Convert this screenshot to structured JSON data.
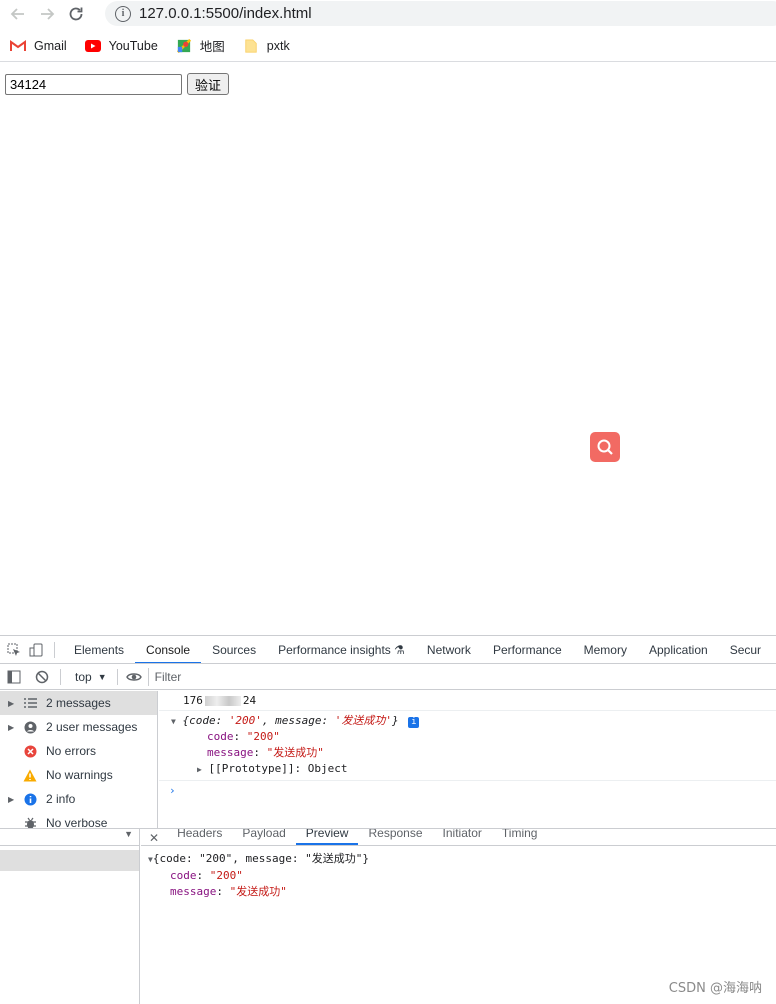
{
  "browser": {
    "url": "127.0.0.1:5500/index.html",
    "bookmarks": [
      {
        "label": "Gmail",
        "icon": "gmail-icon"
      },
      {
        "label": "YouTube",
        "icon": "youtube-icon"
      },
      {
        "label": "地图",
        "icon": "maps-icon"
      },
      {
        "label": "pxtk",
        "icon": "folder-icon"
      }
    ]
  },
  "page": {
    "phone_value": "34124",
    "verify_label": "验证"
  },
  "devtools": {
    "tabs": [
      "Elements",
      "Console",
      "Sources",
      "Performance insights",
      "Network",
      "Performance",
      "Memory",
      "Application",
      "Secur"
    ],
    "active_tab": "Console",
    "context": "top",
    "filter_placeholder": "Filter",
    "sidebar": [
      {
        "label": "2 messages",
        "arrow": "▶",
        "selected": true
      },
      {
        "label": "2 user messages",
        "arrow": "▶"
      },
      {
        "label": "No errors",
        "arrow": ""
      },
      {
        "label": "No warnings",
        "arrow": ""
      },
      {
        "label": "2 info",
        "arrow": "▶"
      },
      {
        "label": "No verbose",
        "arrow": ""
      }
    ],
    "console": {
      "log_prefix": "176",
      "log_suffix": "24",
      "obj_summary_open": "{code: ",
      "obj_summary_code": "'200'",
      "obj_summary_mid": ", message: ",
      "obj_summary_msg": "'发送成功'",
      "obj_summary_close": "}",
      "code_key": "code",
      "code_val": "\"200\"",
      "message_key": "message",
      "message_val": "\"发送成功\"",
      "proto": "[[Prototype]]: Object",
      "prompt": "›"
    }
  },
  "network": {
    "tabs": [
      "Headers",
      "Payload",
      "Preview",
      "Response",
      "Initiator",
      "Timing"
    ],
    "active_tab": "Preview",
    "summary": "{code: \"200\", message: \"发送成功\"}",
    "code_key": "code",
    "code_val": "\"200\"",
    "message_key": "message",
    "message_val": "\"发送成功\""
  },
  "watermark": "CSDN @海海呐"
}
